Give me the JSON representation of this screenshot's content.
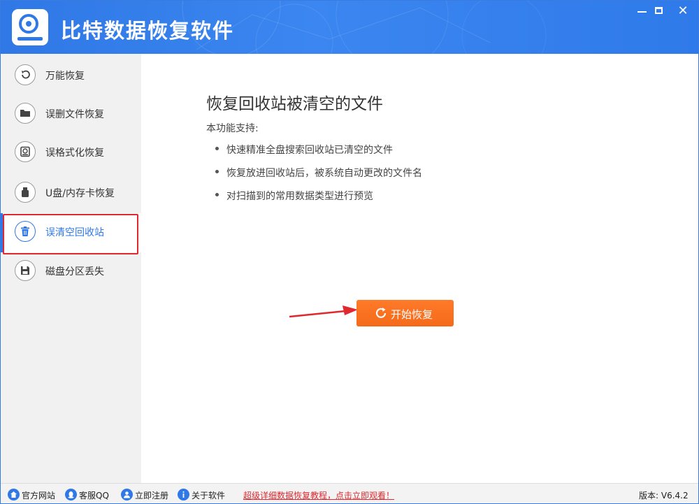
{
  "app": {
    "title": "比特数据恢复软件",
    "controls": {
      "minimize": "—",
      "maximize": "☐",
      "close": "✕"
    }
  },
  "sidebar": {
    "items": [
      {
        "label": "万能恢复",
        "icon": "undo-icon"
      },
      {
        "label": "误删文件恢复",
        "icon": "folder-icon"
      },
      {
        "label": "误格式化恢复",
        "icon": "disk-restore-icon"
      },
      {
        "label": "U盘/内存卡恢复",
        "icon": "usb-icon"
      },
      {
        "label": "误清空回收站",
        "icon": "trash-icon",
        "active": true
      },
      {
        "label": "磁盘分区丢失",
        "icon": "floppy-icon"
      }
    ]
  },
  "main": {
    "heading": "恢复回收站被清空的文件",
    "support_label": "本功能支持:",
    "features": [
      "快速精准全盘搜索回收站已清空的文件",
      "恢复放进回收站后，被系统自动更改的文件名",
      "对扫描到的常用数据类型进行预览"
    ],
    "start_button": "开始恢复"
  },
  "statusbar": {
    "links": [
      {
        "label": "官方网站",
        "icon": "home-icon"
      },
      {
        "label": "客服QQ",
        "icon": "qq-icon"
      },
      {
        "label": "立即注册",
        "icon": "user-icon"
      },
      {
        "label": "关于软件",
        "icon": "info-icon"
      }
    ],
    "promo": "超级详细数据恢复教程，点击立即观看！",
    "version": "版本: V6.4.2"
  },
  "colors": {
    "brand_blue": "#2f78e6",
    "accent_orange": "#f36a1a",
    "highlight_red": "#e0282e"
  }
}
